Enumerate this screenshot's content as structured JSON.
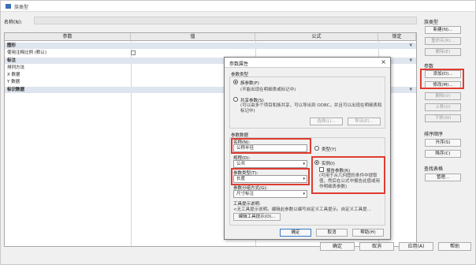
{
  "window": {
    "title": "族类型"
  },
  "name_label": "名称(N):",
  "table": {
    "headers": [
      "参数",
      "值",
      "公式",
      "锁定"
    ],
    "groups": [
      {
        "name": "图形",
        "toggle": "¥",
        "rows": [
          {
            "name": "使用注释比例 (默认)"
          }
        ]
      },
      {
        "name": "标注",
        "toggle": "¥",
        "rows": [
          {
            "name": "排列方法"
          },
          {
            "name": "X 数据"
          },
          {
            "name": "Y 数据"
          }
        ]
      },
      {
        "name": "标识数据",
        "toggle": "¥",
        "rows": []
      }
    ]
  },
  "right_panel": {
    "family_types_label": "族类型",
    "new_btn": "新建(N)...",
    "rename_btn": "重命名(R)...",
    "delete_btn": "删除(E)",
    "params_label": "参数",
    "add_btn": "添加(D)...",
    "modify_btn": "修改(M)...",
    "remove_btn": "删除(V)",
    "up_btn": "上移(U)",
    "down_btn": "下移(W)",
    "sort_label": "排序顺序",
    "asc_btn": "升序(S)",
    "desc_btn": "降序(C)",
    "lookup_label": "查找表格",
    "manage_btn": "管理..."
  },
  "bottom": {
    "ok": "确定",
    "cancel": "取消",
    "apply": "应用(A)",
    "help": "帮助"
  },
  "dialog": {
    "title": "参数属性",
    "close": "×",
    "param_type_label": "参数类型",
    "family_param": "族参数(F)",
    "family_param_desc": "(不能出现在明细表或标记中)",
    "shared_param": "共享参数(S)",
    "shared_param_desc": "(可以由多个项目和族共享，可以导出到 ODBC，并且可以出现在明细表和标记中)",
    "select_btn": "选择(L)...",
    "export_btn": "导出(E)...",
    "param_data_label": "参数数据",
    "name_label": "名称(N):",
    "name_value": "公称半径",
    "type_opt": "类型(Y)",
    "discipline_label": "规程(D):",
    "discipline_value": "公共",
    "param_type_field": "参数类型(T):",
    "param_type_value": "长度",
    "group_label": "参数分组方式(G):",
    "group_value": "尺寸标注",
    "tooltip_label": "工具提示说明:",
    "tooltip_text": "<无工具提示说明。编辑此参数以编写自定义工具提示。自定义工具提...",
    "edit_tooltip_btn": "编辑工具提示(O)...",
    "instance_opt": "实例(I)",
    "report_param": "报告参数(R)",
    "report_desc": "(可用于从几何图形条件中提取值，然后在公式中报告此值或用作明细表参数)",
    "ok": "确定",
    "cancel": "取消",
    "help": "帮助(H)"
  },
  "colors": {
    "highlight": "#e03c31",
    "group_bg": "#dfe5ee"
  }
}
